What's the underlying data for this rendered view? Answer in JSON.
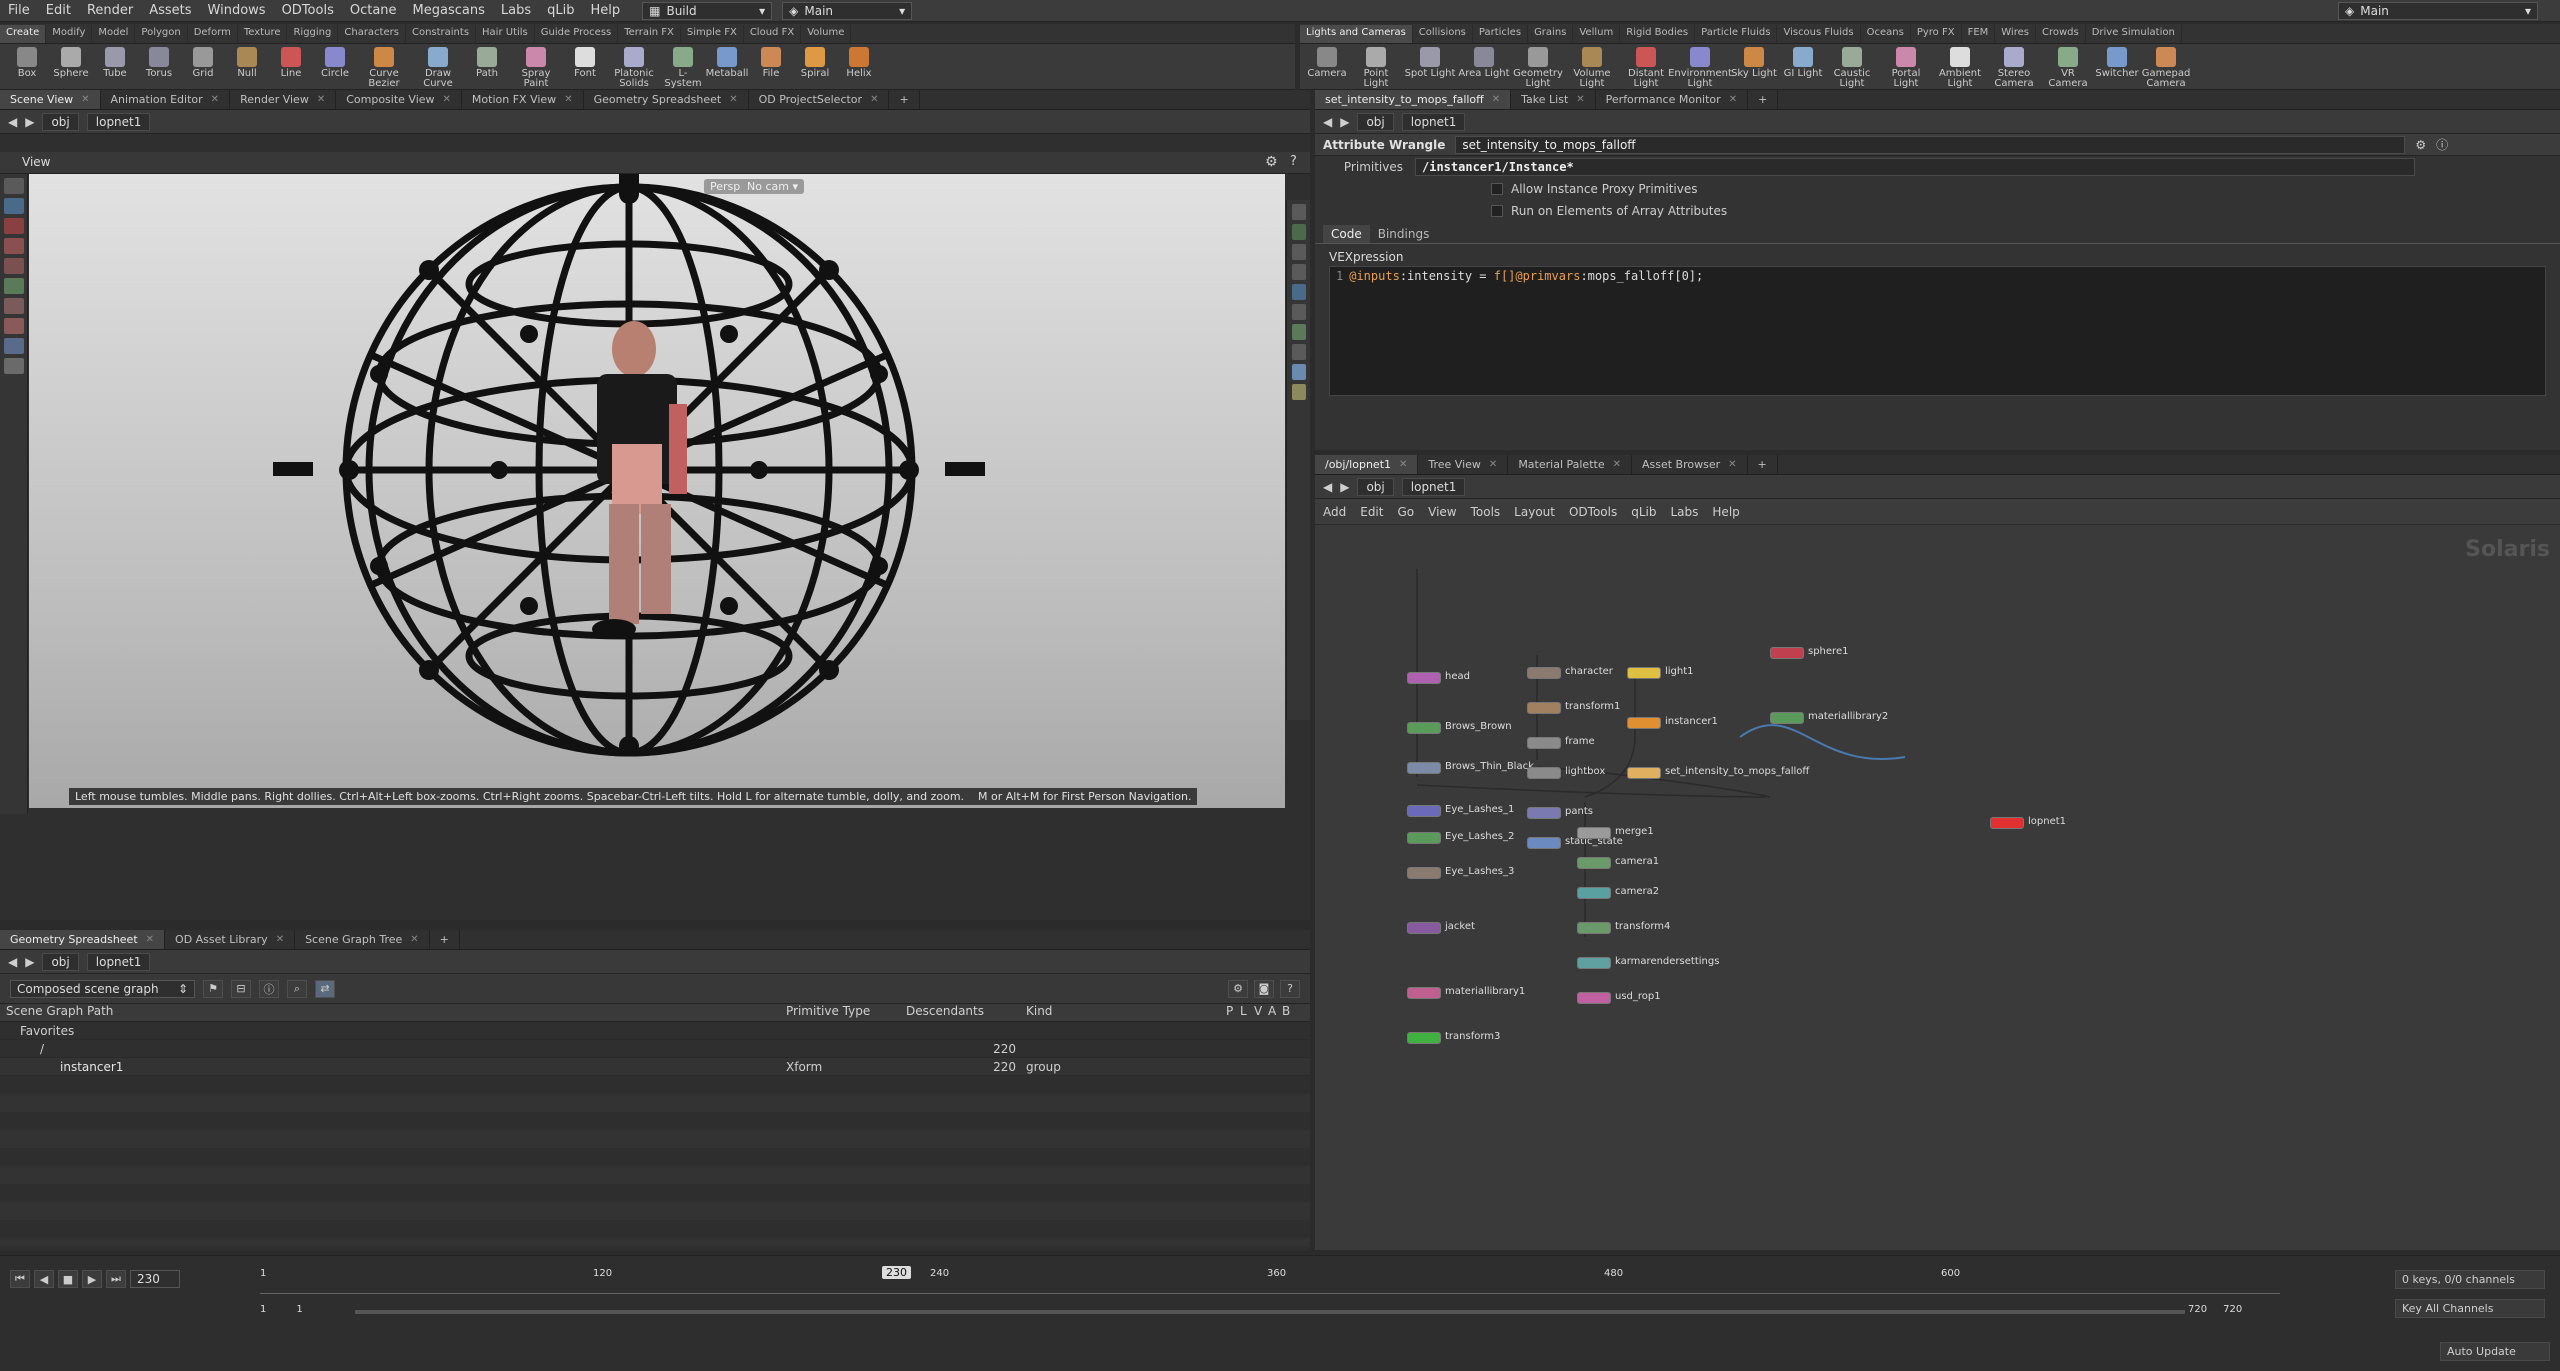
{
  "menubar": {
    "items": [
      "File",
      "Edit",
      "Render",
      "Assets",
      "Windows",
      "ODTools",
      "Octane",
      "Megascans",
      "Labs",
      "qLib",
      "Help"
    ],
    "desktop": "Build",
    "context": "Main",
    "right_context": "Main"
  },
  "shelf_left": {
    "tabs": [
      "Create",
      "Modify",
      "Model",
      "Polygon",
      "Deform",
      "Texture",
      "Rigging",
      "Characters",
      "Constraints",
      "Hair Utils",
      "Guide Process",
      "Terrain FX",
      "Simple FX",
      "Cloud FX",
      "Volume"
    ],
    "tools": [
      "Box",
      "Sphere",
      "Tube",
      "Torus",
      "Grid",
      "Null",
      "Line",
      "Circle",
      "Curve Bezier",
      "Draw Curve",
      "Path",
      "Spray Paint",
      "Font",
      "Platonic Solids",
      "L-System",
      "Metaball",
      "File",
      "Spiral",
      "Helix"
    ]
  },
  "shelf_right": {
    "tabs": [
      "Lights and Cameras",
      "Collisions",
      "Particles",
      "Grains",
      "Vellum",
      "Rigid Bodies",
      "Particle Fluids",
      "Viscous Fluids",
      "Oceans",
      "Pyro FX",
      "FEM",
      "Wires",
      "Crowds",
      "Drive Simulation"
    ],
    "tools": [
      "Camera",
      "Point Light",
      "Spot Light",
      "Area Light",
      "Geometry Light",
      "Volume Light",
      "Distant Light",
      "Environment Light",
      "Sky Light",
      "GI Light",
      "Caustic Light",
      "Portal Light",
      "Ambient Light",
      "Stereo Camera",
      "VR Camera",
      "Switcher",
      "Gamepad Camera"
    ]
  },
  "scene_tabs": [
    "Scene View",
    "Animation Editor",
    "Render View",
    "Composite View",
    "Motion FX View",
    "Geometry Spreadsheet",
    "OD ProjectSelector"
  ],
  "path": {
    "root": "obj",
    "node": "lopnet1"
  },
  "viewport": {
    "title": "View",
    "persp": "Persp",
    "cam": "No cam",
    "hint": "Left mouse tumbles. Middle pans. Right dollies. Ctrl+Alt+Left box-zooms. Ctrl+Right zooms. Spacebar-Ctrl-Left tilts. Hold L for alternate tumble, dolly, and zoom.",
    "hint2": "M or Alt+M for First Person Navigation."
  },
  "param": {
    "tabs": [
      "set_intensity_to_mops_falloff",
      "Take List",
      "Performance Monitor"
    ],
    "node_type": "Attribute Wrangle",
    "node_name": "set_intensity_to_mops_falloff",
    "primitives_label": "Primitives",
    "primitives_value": "/instancer1/Instance*",
    "chk1": "Allow Instance Proxy Primitives",
    "chk2": "Run on Elements of Array Attributes",
    "sub_tabs": [
      "Code",
      "Bindings"
    ],
    "vex_label": "VEXpression",
    "line_no": "1",
    "code_a": "@inputs",
    "code_b": ":intensity = ",
    "code_c": "f[]@primvars",
    "code_d": ":mops_falloff[0];"
  },
  "network": {
    "tabs": [
      "/obj/lopnet1",
      "Tree View",
      "Material Palette",
      "Asset Browser"
    ],
    "menu": [
      "Add",
      "Edit",
      "Go",
      "View",
      "Tools",
      "Layout",
      "ODTools",
      "qLib",
      "Labs",
      "Help"
    ],
    "context_label": "Solaris",
    "nodes": [
      {
        "label": "head",
        "color": "#b060b0"
      },
      {
        "label": "Brows_Brown",
        "color": "#5a9a5a"
      },
      {
        "label": "Brows_Thin_Black",
        "color": "#7a8aa8"
      },
      {
        "label": "Eye_Lashes_1",
        "color": "#6a6ab8"
      },
      {
        "label": "Eye_Lashes_2",
        "color": "#5a9a5a"
      },
      {
        "label": "Eye_Lashes_3",
        "color": "#8a7a70"
      },
      {
        "label": "jacket",
        "color": "#8a5aa0"
      },
      {
        "label": "materiallibrary1",
        "color": "#c06090"
      },
      {
        "label": "transform3",
        "color": "#40b040"
      },
      {
        "label": "character",
        "color": "#8a7a70"
      },
      {
        "label": "transform1",
        "color": "#a08060"
      },
      {
        "label": "frame",
        "color": "#8a8a8a"
      },
      {
        "label": "lightbox",
        "color": "#8a8a8a"
      },
      {
        "label": "pants",
        "color": "#7a7ab0"
      },
      {
        "label": "static_state",
        "color": "#6a8ac0"
      },
      {
        "label": "light1",
        "color": "#e0c040"
      },
      {
        "label": "instancer1",
        "color": "#e09030"
      },
      {
        "label": "set_intensity_to_mops_falloff",
        "color": "#e0b060"
      },
      {
        "label": "merge1",
        "color": "#9a9a9a"
      },
      {
        "label": "camera1",
        "color": "#6a9a6a"
      },
      {
        "label": "camera2",
        "color": "#5aa0a0"
      },
      {
        "label": "transform4",
        "color": "#6a9a6a"
      },
      {
        "label": "karmarendersettings",
        "color": "#60a0a0"
      },
      {
        "label": "usd_rop1",
        "color": "#c060a0"
      },
      {
        "label": "sphere1",
        "color": "#c04050"
      },
      {
        "label": "materiallibrary2",
        "color": "#5a9a5a"
      },
      {
        "label": "lopnet1",
        "color": "#e03030"
      }
    ]
  },
  "sg": {
    "tabs": [
      "Geometry Spreadsheet",
      "OD Asset Library",
      "Scene Graph Tree"
    ],
    "mode": "Composed scene graph",
    "cols": [
      "Scene Graph Path",
      "Primitive Type",
      "Descendants",
      "Kind",
      "P",
      "L",
      "V",
      "A",
      "B"
    ],
    "rows": [
      {
        "path": "Favorites",
        "type": "",
        "desc": "",
        "kind": ""
      },
      {
        "path": "/",
        "type": "",
        "desc": "220",
        "kind": ""
      },
      {
        "path": "instancer1",
        "type": "Xform",
        "desc": "220",
        "kind": "group"
      }
    ]
  },
  "timeline": {
    "frame": "230",
    "ticks": [
      "1",
      "120",
      "240",
      "360",
      "480",
      "600"
    ],
    "marker": "230",
    "start": "1",
    "start2": "1",
    "end": "720",
    "end2": "720",
    "keys": "0 keys, 0/0 channels",
    "key_all": "Key All Channels",
    "auto": "Auto Update"
  }
}
